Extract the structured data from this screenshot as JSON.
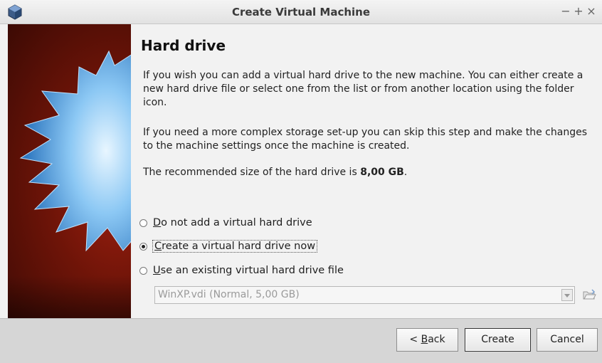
{
  "window": {
    "title": "Create Virtual Machine",
    "minimize_glyph": "−",
    "maximize_glyph": "+",
    "close_glyph": "×",
    "app_icon": "virtualbox-cube-icon"
  },
  "page": {
    "heading": "Hard drive",
    "paragraph1": "If you wish you can add a virtual hard drive to the new machine. You can either create a new hard drive file or select one from the list or from another location using the folder icon.",
    "paragraph2": "If you need a more complex storage set-up you can skip this step and make the changes to the machine settings once the machine is created.",
    "paragraph3_prefix": "The recommended size of the hard drive is ",
    "paragraph3_size": "8,00 GB",
    "paragraph3_suffix": "."
  },
  "options": [
    {
      "mnemonic": "D",
      "rest": "o not add a virtual hard drive",
      "selected": false
    },
    {
      "mnemonic": "C",
      "rest": "reate a virtual hard drive now",
      "selected": true
    },
    {
      "mnemonic": "U",
      "rest": "se an existing virtual hard drive file",
      "selected": false
    }
  ],
  "existing_file_combo": {
    "value": "WinXP.vdi (Normal, 5,00 GB)",
    "enabled": false
  },
  "folder_button_icon": "folder-open-icon",
  "buttons": {
    "back_prefix": "< ",
    "back_mnemonic": "B",
    "back_rest": "ack",
    "create": "Create",
    "cancel": "Cancel"
  },
  "colors": {
    "banner_red": "#8a1a0a",
    "star_blue": "#6ab4f0"
  }
}
